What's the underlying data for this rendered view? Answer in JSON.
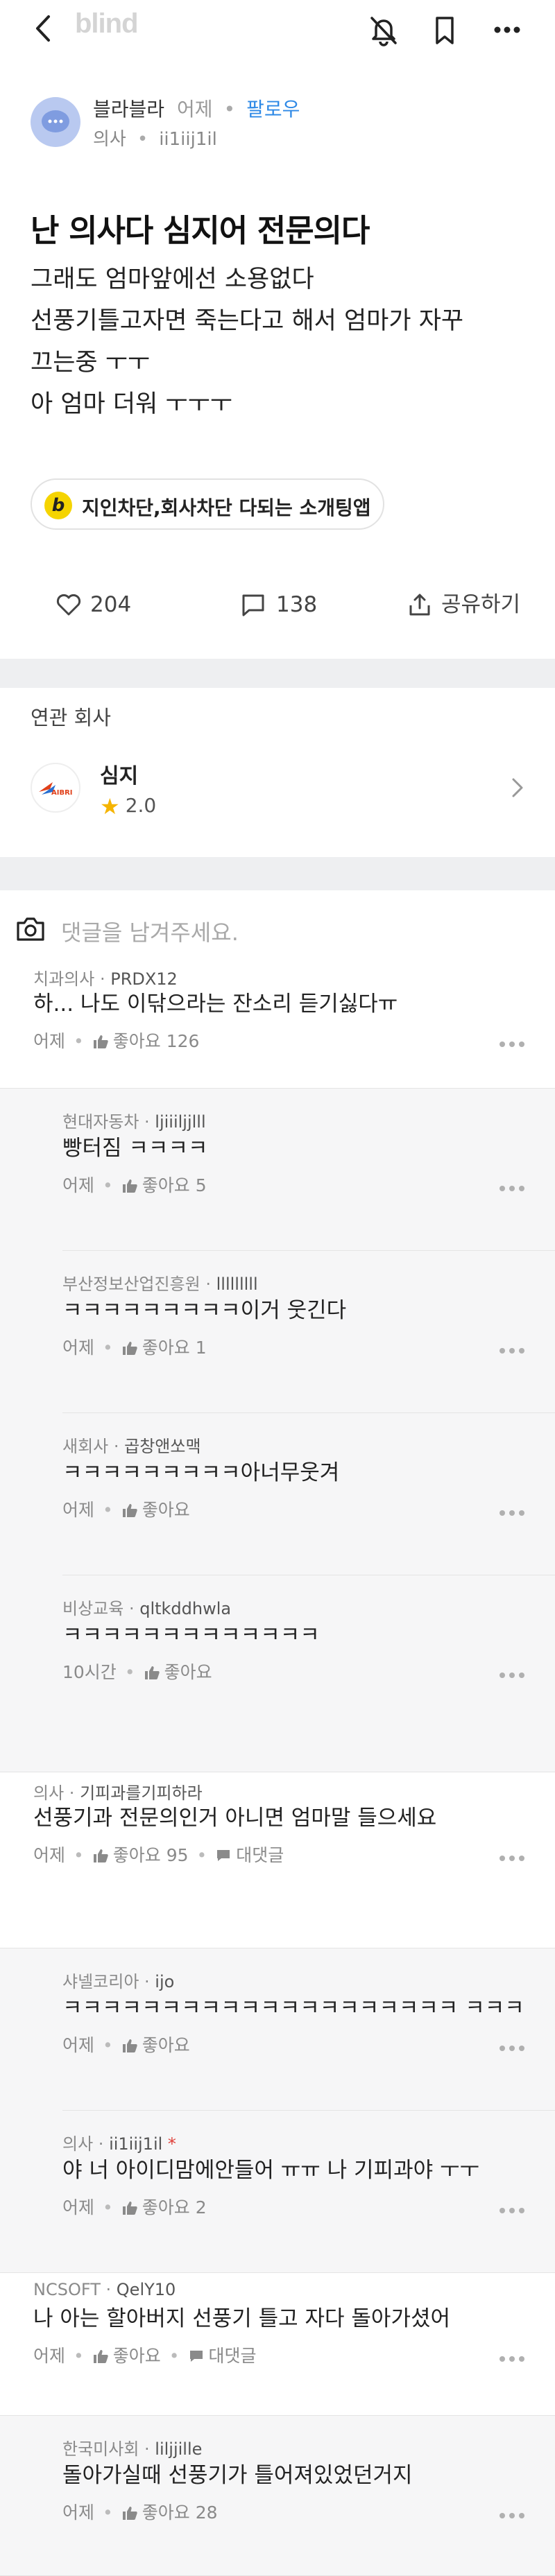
{
  "app": {
    "logo": "blind"
  },
  "post": {
    "author_name": "블라블라",
    "date": "어제",
    "follow_label": "팔로우",
    "author_company": "의사",
    "author_id": "ii1iij1il",
    "title": "난 의사다 심지어 전문의다",
    "body": [
      "그래도 엄마앞에선 소용없다",
      "선풍기틀고자면 죽는다고 해서 엄마가 자꾸",
      "끄는중 ㅜㅜ",
      "아 엄마 더워 ㅜㅜㅜ"
    ],
    "ad_label": "지인차단,회사차단 다되는 소개팅앱",
    "likes": "204",
    "comments": "138",
    "share_label": "공유하기"
  },
  "related": {
    "label": "연관 회사",
    "company_name": "심지",
    "rating": "2.0",
    "logo_text": "AIBRI"
  },
  "comment_input": {
    "placeholder": "댓글을 남겨주세요."
  },
  "comments": [
    {
      "company": "치과의사",
      "nick": "PRDX12",
      "text": "하... 나도 이닦으라는 잔소리 듣기싫다ㅠ",
      "time": "어제",
      "like_label": "좋아요 126",
      "reply_label": ""
    },
    {
      "company": "현대자동차",
      "nick": "ljiiiljjlll",
      "text": "빵터짐 ㅋㅋㅋㅋ",
      "time": "어제",
      "like_label": "좋아요 5",
      "reply_label": ""
    },
    {
      "company": "부산정보산업진흥원",
      "nick": "lllllllll",
      "text": "ㅋㅋㅋㅋㅋㅋㅋㅋㅋ이거 웃긴다",
      "time": "어제",
      "like_label": "좋아요 1",
      "reply_label": ""
    },
    {
      "company": "새회사",
      "nick": "곱창앤쏘맥",
      "text": "ㅋㅋㅋㅋㅋㅋㅋㅋㅋ아너무웃겨",
      "time": "어제",
      "like_label": "좋아요",
      "reply_label": ""
    },
    {
      "company": "비상교육",
      "nick": "qltkddhwla",
      "text": "ㅋㅋㅋㅋㅋㅋㅋㅋㅋㅋㅋㅋㅋ",
      "time": "10시간",
      "like_label": "좋아요",
      "reply_label": ""
    },
    {
      "company": "의사",
      "nick": "기피과를기피하라",
      "text": "선풍기과 전문의인거 아니면 엄마말 들으세요",
      "time": "어제",
      "like_label": "좋아요 95",
      "reply_label": "대댓글"
    },
    {
      "company": "샤넬코리아",
      "nick": "ijo",
      "text": "ㅋㅋㅋㅋㅋㅋㅋㅋㅋㅋㅋㅋㅋㅋㅋㅋㅋㅋㅋㅋ ㅋㅋㅋ",
      "time": "어제",
      "like_label": "좋아요",
      "reply_label": ""
    },
    {
      "company": "의사",
      "nick": "ii1iij1il",
      "text": "야 너 아이디맘에안들어 ㅠㅠ 나 기피과야 ㅜㅜ",
      "time": "어제",
      "like_label": "좋아요 2",
      "reply_label": ""
    },
    {
      "company": "NCSOFT",
      "nick": "QelY10",
      "text": "나 아는 할아버지 선풍기 틀고 자다 돌아가셨어",
      "time": "어제",
      "like_label": "좋아요",
      "reply_label": "대댓글"
    },
    {
      "company": "한국미사회",
      "nick": "liljjille",
      "text": "돌아가실때 선풍기가 틀어져있었던거지",
      "time": "어제",
      "like_label": "좋아요 28",
      "reply_label": ""
    }
  ],
  "author_marker": "*",
  "colors": {
    "accent": "#2e89e6",
    "logo": "#d4d4d4",
    "reply_bg": "#f6f6f7",
    "section_bg": "#eeeff1"
  }
}
